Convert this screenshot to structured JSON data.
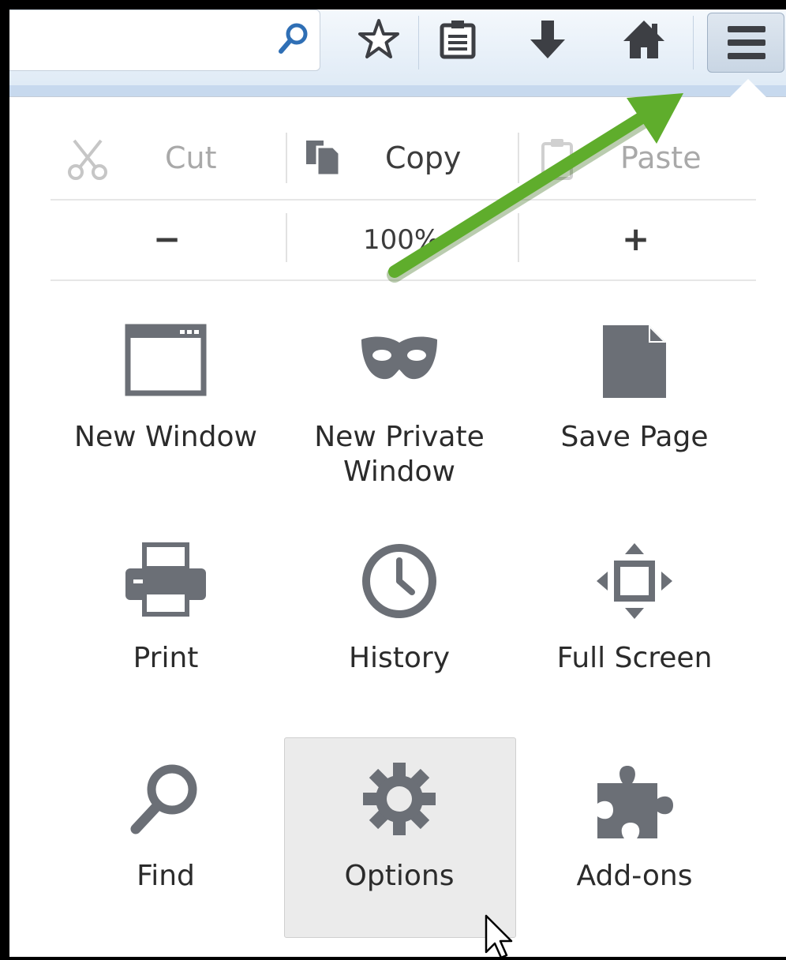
{
  "edit": {
    "cut_label": "Cut",
    "copy_label": "Copy",
    "paste_label": "Paste"
  },
  "zoom": {
    "minus_label": "−",
    "level": "100%",
    "plus_label": "+"
  },
  "menu_items": [
    {
      "label": "New Window",
      "icon": "new-window-icon"
    },
    {
      "label": "New Private Window",
      "icon": "mask-icon"
    },
    {
      "label": "Save Page",
      "icon": "page-icon"
    },
    {
      "label": "Print",
      "icon": "printer-icon"
    },
    {
      "label": "History",
      "icon": "clock-icon"
    },
    {
      "label": "Full Screen",
      "icon": "fullscreen-icon"
    },
    {
      "label": "Find",
      "icon": "magnifier-icon"
    },
    {
      "label": "Options",
      "icon": "gear-icon"
    },
    {
      "label": "Add-ons",
      "icon": "puzzle-icon"
    }
  ],
  "colors": {
    "icon_gray": "#6b6f76",
    "arrow_green": "#5fad2c",
    "hover_bg": "#ebebeb",
    "search_blue": "#2f6fb5"
  }
}
